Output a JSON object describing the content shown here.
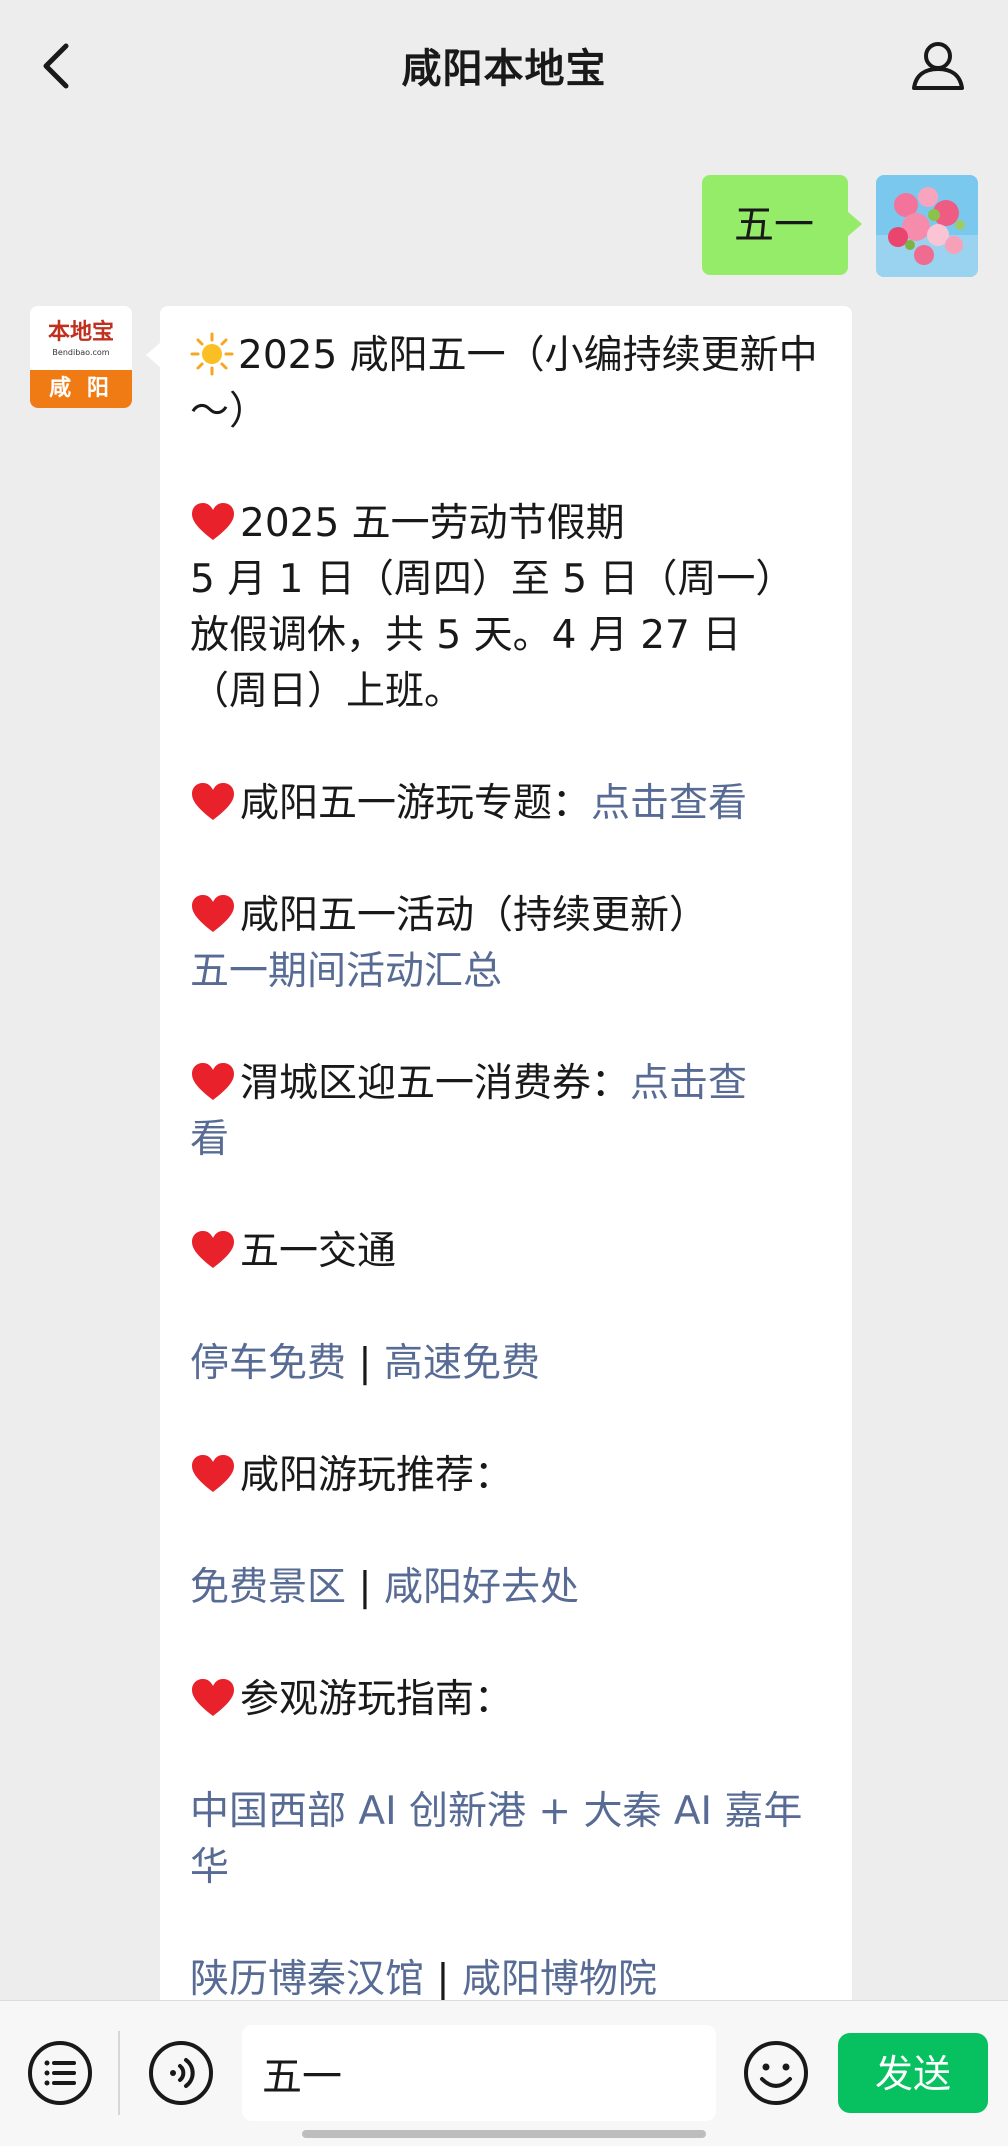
{
  "header": {
    "title": "咸阳本地宝",
    "back_icon": "chevron-left-icon",
    "profile_icon": "person-icon"
  },
  "outgoing": {
    "text": "五一"
  },
  "incoming": {
    "avatar": {
      "brand": "本地宝",
      "domain": "Bendibao.com",
      "city": "咸 阳"
    },
    "intro": "2025 咸阳五一（小编持续更新中～）",
    "holiday": {
      "title": "2025 五一劳动节假期",
      "line1": "5 月 1 日（周四）至 5 日（周一）",
      "line2": "放假调休，共 5 天。4 月 27 日",
      "line3": "（周日）上班。"
    },
    "topic": {
      "label": "咸阳五一游玩专题：",
      "link": "点击查看"
    },
    "activities": {
      "label": "咸阳五一活动（持续更新）",
      "link": "五一期间活动汇总"
    },
    "coupon": {
      "label": "渭城区迎五一消费券：",
      "link_part1": "点击查",
      "link_part2": "看"
    },
    "traffic": {
      "label": "五一交通",
      "link1": "停车免费",
      "separator": "|",
      "link2": "高速免费"
    },
    "recommend": {
      "label": "咸阳游玩推荐：",
      "link1": "免费景区",
      "separator": "|",
      "link2": "咸阳好去处"
    },
    "guide": {
      "label": "参观游玩指南：",
      "link_a_line1": "中国西部 AI 创新港 + 大秦 AI 嘉年",
      "link_a_line2": "华",
      "link_b1": "陕历博秦汉馆",
      "separator": "|",
      "link_b2": "咸阳博物院"
    }
  },
  "input_bar": {
    "value": "五一",
    "send_label": "发送",
    "menu_icon": "list-icon",
    "voice_icon": "voice-icon",
    "emoji_icon": "smiley-icon"
  },
  "colors": {
    "background": "#ededed",
    "outgoing_bubble": "#95ec69",
    "link": "#576b95",
    "send_button": "#07c160",
    "heart": "#e8212b"
  }
}
